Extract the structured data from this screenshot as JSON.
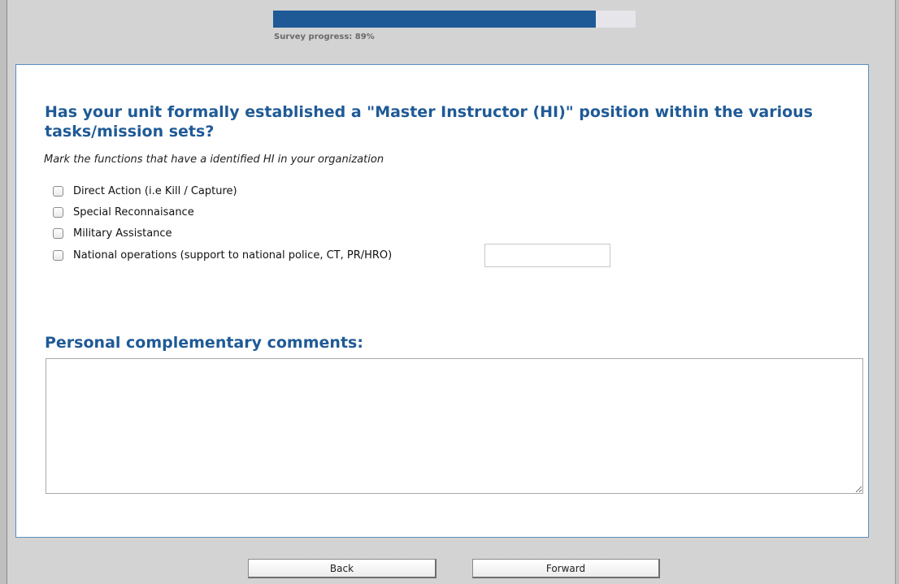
{
  "progress": {
    "label": "Survey progress: 89%",
    "fraction": 0.89
  },
  "question": {
    "title": "Has your unit formally established a \"Master Instructor (HI)\" position within the various tasks/mission sets?",
    "instruction": "Mark the functions that have a identified HI in your organization",
    "options": [
      {
        "label": "Direct Action (i.e Kill / Capture)",
        "checked": false
      },
      {
        "label": "Special Reconnaisance",
        "checked": false
      },
      {
        "label": "Military Assistance",
        "checked": false
      },
      {
        "label": "National operations (support to national police, CT, PR/HRO)",
        "checked": false
      }
    ],
    "other_value": ""
  },
  "comments": {
    "title": "Personal complementary comments:",
    "value": ""
  },
  "nav": {
    "back_label": "Back",
    "forward_label": "Forward"
  },
  "colors": {
    "accent": "#1f5a96",
    "progress_track": "#e6e6ea",
    "panel_border": "#5b8ec0",
    "page_background": "#d3d3d3"
  }
}
